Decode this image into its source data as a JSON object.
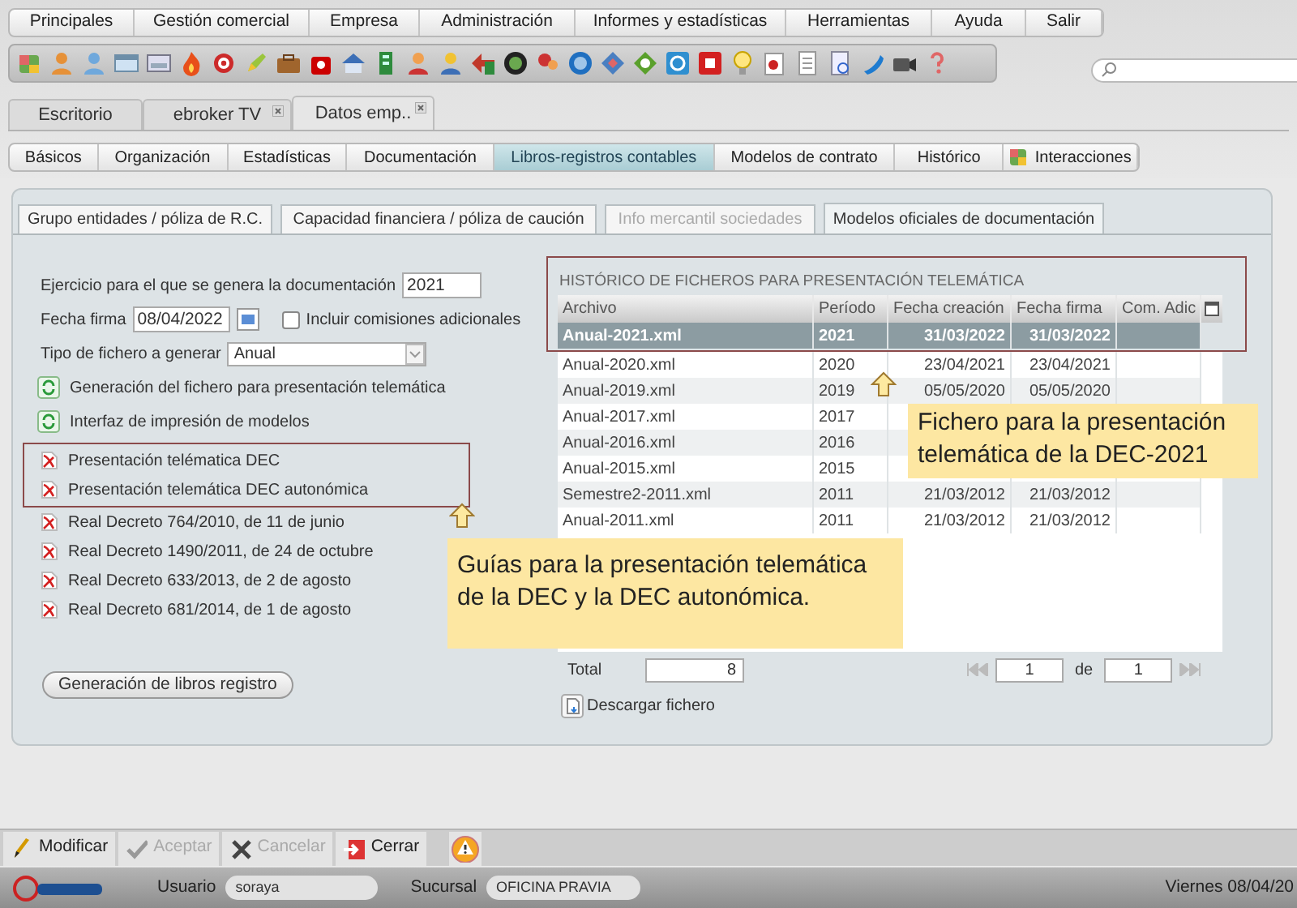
{
  "menu_bar": [
    {
      "label": "Principales"
    },
    {
      "label": "Gestión comercial"
    },
    {
      "label": "Empresa"
    },
    {
      "label": "Administración"
    },
    {
      "label": "Informes y estadísticas"
    },
    {
      "label": "Herramientas"
    },
    {
      "label": "Ayuda"
    },
    {
      "label": "Salir"
    }
  ],
  "window_tabs": [
    {
      "label": "Escritorio",
      "selected": false,
      "closable": false
    },
    {
      "label": "ebroker TV",
      "selected": false,
      "closable": true
    },
    {
      "label": "Datos emp..",
      "selected": true,
      "closable": true
    }
  ],
  "section_tabs": [
    {
      "label": "Básicos",
      "selected": false
    },
    {
      "label": "Organización",
      "selected": false
    },
    {
      "label": "Estadísticas",
      "selected": false
    },
    {
      "label": "Documentación",
      "selected": false
    },
    {
      "label": "Libros-registros contables",
      "selected": true
    },
    {
      "label": "Modelos de contrato",
      "selected": false
    },
    {
      "label": "Histórico",
      "selected": false
    },
    {
      "label": "Interacciones",
      "selected": false
    }
  ],
  "inner_tabs": [
    {
      "label": "Grupo entidades / póliza de R.C.",
      "selected": false,
      "disabled": false
    },
    {
      "label": "Capacidad financiera / póliza de caución",
      "selected": false,
      "disabled": false
    },
    {
      "label": "Info mercantil sociedades",
      "selected": false,
      "disabled": true
    },
    {
      "label": "Modelos oficiales de documentación",
      "selected": true,
      "disabled": false
    }
  ],
  "form": {
    "ejercicio": {
      "label": "Ejercicio para el que se genera la documentación",
      "value": "2021"
    },
    "fecha_firma": {
      "label": "Fecha firma",
      "value": "08/04/2022"
    },
    "incluir_comisiones": {
      "label": "Incluir comisiones adicionales",
      "checked": false
    },
    "tipo_fichero": {
      "label": "Tipo de fichero a generar",
      "value": "Anual"
    }
  },
  "actions": [
    {
      "label": "Generación del fichero para presentación telemática"
    },
    {
      "label": "Interfaz de impresión de modelos"
    }
  ],
  "documents": [
    {
      "label": "Presentación telématica DEC"
    },
    {
      "label": "Presentación telemática DEC autonómica"
    },
    {
      "label": "Real Decreto 764/2010, de 11 de junio"
    },
    {
      "label": "Real Decreto 1490/2011, de 24 de octubre"
    },
    {
      "label": "Real Decreto 633/2013, de 2 de agosto"
    },
    {
      "label": "Real Decreto 681/2014, de 1 de agosto"
    }
  ],
  "generate_button": "Generación de libros registro",
  "history": {
    "title": "HISTÓRICO DE FICHEROS PARA PRESENTACIÓN TELEMÁTICA",
    "columns": [
      "Archivo",
      "Período",
      "Fecha creación",
      "Fecha firma",
      "Com. Adic"
    ],
    "rows": [
      {
        "archivo": "Anual-2021.xml",
        "periodo": "2021",
        "fecha_creacion": "31/03/2022",
        "fecha_firma": "31/03/2022",
        "selected": true
      },
      {
        "archivo": "Anual-2020.xml",
        "periodo": "2020",
        "fecha_creacion": "23/04/2021",
        "fecha_firma": "23/04/2021",
        "selected": false
      },
      {
        "archivo": "Anual-2019.xml",
        "periodo": "2019",
        "fecha_creacion": "05/05/2020",
        "fecha_firma": "05/05/2020",
        "selected": false
      },
      {
        "archivo": "Anual-2017.xml",
        "periodo": "2017",
        "selected": false
      },
      {
        "archivo": "Anual-2016.xml",
        "periodo": "2016",
        "selected": false
      },
      {
        "archivo": "Anual-2015.xml",
        "periodo": "2015",
        "selected": false
      },
      {
        "archivo": "Semestre2-2011.xml",
        "periodo": "2011",
        "fecha_creacion": "21/03/2012",
        "fecha_firma": "21/03/2012",
        "selected": false
      },
      {
        "archivo": "Anual-2011.xml",
        "periodo": "2011",
        "fecha_creacion": "21/03/2012",
        "fecha_firma": "21/03/2012",
        "selected": false
      }
    ],
    "total_label": "Total",
    "total": "8",
    "page": "1",
    "of_label": "de",
    "pages": "1",
    "download": "Descargar fichero"
  },
  "callouts": [
    {
      "text": "Fichero para la presentación telemática de la DEC-2021"
    },
    {
      "text": "Guías para la presentación telemática de la DEC y la DEC autonómica."
    }
  ],
  "toolbar": [
    {
      "label": "Modificar",
      "disabled": false
    },
    {
      "label": "Aceptar",
      "disabled": true
    },
    {
      "label": "Cancelar",
      "disabled": true
    },
    {
      "label": "Cerrar",
      "disabled": false
    }
  ],
  "status_bar": {
    "user_label": "Usuario",
    "user": "soraya",
    "branch_label": "Sucursal",
    "branch": "OFICINA PRAVIA",
    "date": "Viernes 08/04/20"
  }
}
